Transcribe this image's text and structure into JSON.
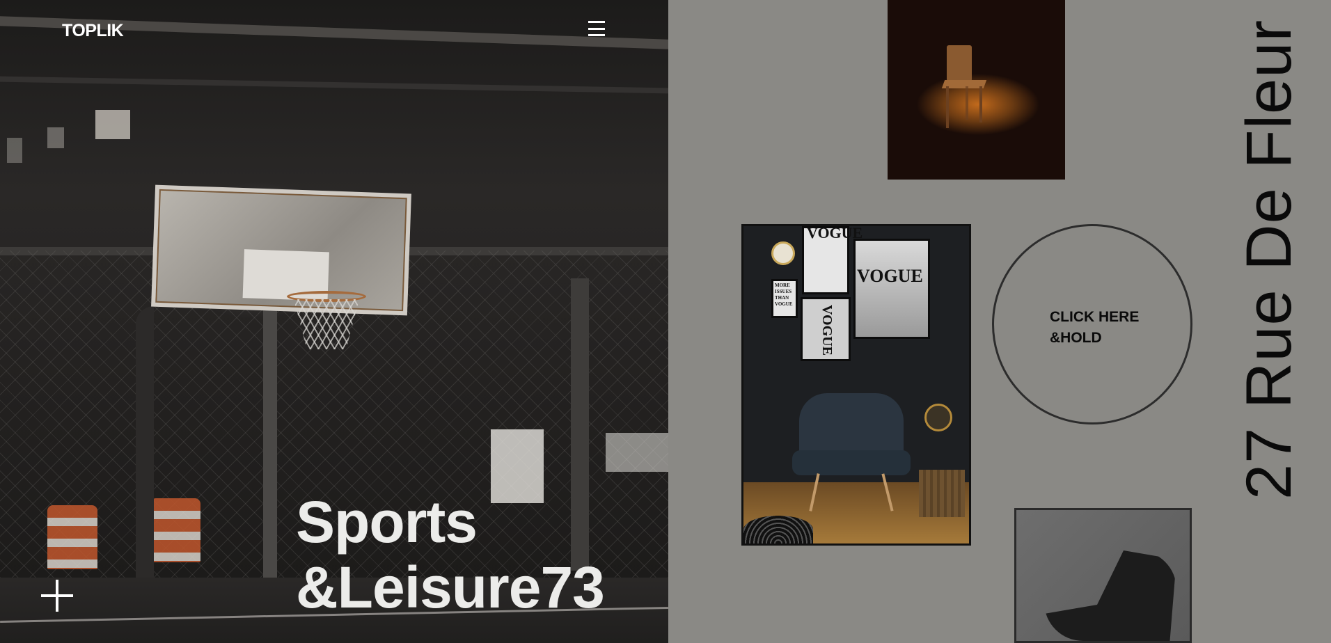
{
  "header": {
    "logo": "TOPLIK",
    "menu_icon": "hamburger-menu-icon"
  },
  "hero": {
    "title_line1": "Sports",
    "title_line2": "&Leisure73",
    "expand_icon": "plus-icon",
    "image": "basketball-court-photo"
  },
  "gallery": {
    "images": [
      "spotlit-wooden-chair-photo",
      "vogue-wall-armchair-photo",
      "black-shell-chair-photo"
    ],
    "vogue_frames": [
      "VOGUE",
      "VOGUE",
      "VOGUE",
      "MORE ISSUES THAN VOGUE"
    ]
  },
  "cta": {
    "label": "CLICK HERE\n&HOLD"
  },
  "address": "27 Rue De Fleur",
  "colors": {
    "right_panel_bg": "#8a8985",
    "hero_text": "#ececea",
    "dark_text": "#0a0a0a"
  }
}
